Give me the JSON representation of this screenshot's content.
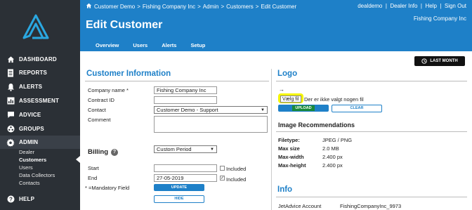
{
  "sidebar": {
    "items": [
      {
        "label": "DASHBOARD",
        "icon": "home-icon"
      },
      {
        "label": "REPORTS",
        "icon": "document-icon"
      },
      {
        "label": "ALERTS",
        "icon": "bell-icon"
      },
      {
        "label": "ASSESSMENT",
        "icon": "chart-icon"
      },
      {
        "label": "ADVICE",
        "icon": "chat-icon"
      },
      {
        "label": "GROUPS",
        "icon": "groups-icon"
      },
      {
        "label": "ADMIN",
        "icon": "gear-icon"
      },
      {
        "label": "HELP",
        "icon": "help-icon"
      }
    ],
    "admin_sub": [
      "Dealer",
      "Customers",
      "Users",
      "Data Collectors",
      "Contacts"
    ]
  },
  "header": {
    "breadcrumb": [
      "Customer Demo",
      ">",
      "Fishing Company Inc",
      ">",
      "Admin",
      ">",
      "Customers",
      ">",
      "Edit Customer"
    ],
    "toplinks": "dealdemo  |  Dealer Info  |  Help  |  Sign Out",
    "company": "Fishing Company Inc",
    "title": "Edit Customer",
    "tabs": [
      "Overview",
      "Users",
      "Alerts",
      "Setup"
    ]
  },
  "period_button": "LAST MONTH",
  "customer_info": {
    "title": "Customer Information",
    "company_label": "Company name *",
    "company_value": "Fishing Company Inc",
    "contract_label": "Contract ID",
    "contract_value": "",
    "contact_label": "Contact",
    "contact_value": "Customer Demo - Support",
    "comment_label": "Comment"
  },
  "billing": {
    "title": "Billing",
    "period_value": "Custom Period",
    "start_label": "Start",
    "start_value": "",
    "end_label": "End",
    "end_value": "27-05-2019",
    "included_label": "Included",
    "mandatory_note": "* =Mandatory Field",
    "update_label": "UPDATE",
    "hide_label": "HIDE"
  },
  "logo_section": {
    "title": "Logo",
    "arrow": "→",
    "choose_file": "Vælg fil",
    "no_file": "Der er ikke valgt nogen fil",
    "upload_label": "UPLOAD",
    "clear_label": "CLEAR"
  },
  "image_rec": {
    "title": "Image Recommendations",
    "rows": [
      {
        "label": "Filetype:",
        "value": "JPEG / PNG"
      },
      {
        "label": "Max size",
        "value": "2.0 MB"
      },
      {
        "label": "Max-width",
        "value": "2.400 px"
      },
      {
        "label": "Max-height",
        "value": "2.400 px"
      }
    ]
  },
  "info": {
    "title": "Info",
    "account_label": "JetAdvice Account",
    "account_value": "FishingCompanyInc_9973"
  },
  "colors": {
    "accent": "#1e80c8",
    "sidebar": "#2b3036",
    "highlight": "#f5f500",
    "upload_green": "#1a8a3a"
  }
}
